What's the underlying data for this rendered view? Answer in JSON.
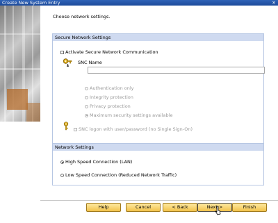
{
  "window": {
    "title": "Create New System Entry",
    "close_glyph": "✕"
  },
  "heading": "Choose network settings.",
  "secure_group": {
    "title": "Secure Network Settings",
    "activate_label": "Activate Secure Network Communication",
    "activate_checked": false,
    "snc_name_label": "SNC Name",
    "snc_name_value": "",
    "protection_options": [
      {
        "label": "Authentication only",
        "selected": false
      },
      {
        "label": "Integrity protection",
        "selected": false
      },
      {
        "label": "Privacy protection",
        "selected": false
      },
      {
        "label": "Maximum security settings available",
        "selected": true
      }
    ],
    "snc_logon_label": "SNC logon with user/password (no Single Sign-On)",
    "snc_logon_checked": false
  },
  "network_group": {
    "title": "Network Settings",
    "options": [
      {
        "label": "High Speed Connection (LAN)",
        "selected": true
      },
      {
        "label": "Low Speed Connection (Reduced Network Traffic)",
        "selected": false
      }
    ]
  },
  "buttons": {
    "help": "Help",
    "cancel": "Cancel",
    "back": "< Back",
    "next": "Next >",
    "finish": "Finish"
  },
  "icons": {
    "key": "key-icon",
    "cursor": "mouse-cursor-icon"
  },
  "colors": {
    "title_bar": "#2f63b8",
    "group_header": "#cfdaf0",
    "button": "#f1c24b"
  }
}
